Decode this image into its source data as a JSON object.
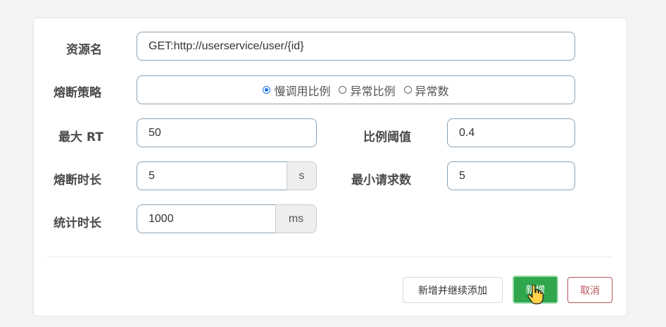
{
  "form": {
    "resource_name": {
      "label": "资源名",
      "value": "GET:http://userservice/user/{id}"
    },
    "strategy": {
      "label": "熔断策略",
      "options": [
        {
          "label": "慢调用比例",
          "checked": true
        },
        {
          "label": "异常比例",
          "checked": false
        },
        {
          "label": "异常数",
          "checked": false
        }
      ]
    },
    "max_rt": {
      "label": "最大 RT",
      "value": "50"
    },
    "ratio_threshold": {
      "label": "比例阈值",
      "value": "0.4"
    },
    "break_duration": {
      "label": "熔断时长",
      "value": "5",
      "unit": "s"
    },
    "min_requests": {
      "label": "最小请求数",
      "value": "5"
    },
    "stat_duration": {
      "label": "统计时长",
      "value": "1000",
      "unit": "ms"
    }
  },
  "buttons": {
    "add_continue": "新增并继续添加",
    "add": "新增",
    "cancel": "取消"
  },
  "colors": {
    "primary": "#2fa64c",
    "danger": "#b8545c",
    "radio": "#1a73e8"
  }
}
